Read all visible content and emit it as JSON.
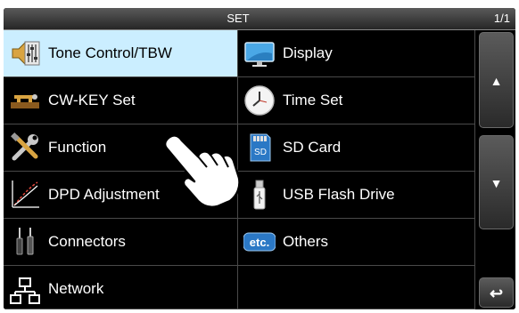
{
  "header": {
    "title": "SET",
    "page": "1/1"
  },
  "menu": {
    "items": [
      {
        "label": "Tone Control/TBW",
        "icon": "tone-control-icon"
      },
      {
        "label": "Display",
        "icon": "monitor-icon"
      },
      {
        "label": "CW-KEY Set",
        "icon": "cw-key-icon"
      },
      {
        "label": "Time Set",
        "icon": "clock-icon"
      },
      {
        "label": "Function",
        "icon": "tools-icon"
      },
      {
        "label": "SD Card",
        "icon": "sd-card-icon",
        "icon_text": "SD"
      },
      {
        "label": "DPD Adjustment",
        "icon": "dpd-graph-icon"
      },
      {
        "label": "USB Flash Drive",
        "icon": "usb-drive-icon"
      },
      {
        "label": "Connectors",
        "icon": "connectors-icon"
      },
      {
        "label": "Others",
        "icon": "others-icon",
        "icon_text": "etc."
      },
      {
        "label": "Network",
        "icon": "network-icon"
      }
    ],
    "selected_index": 0
  },
  "scrollbar": {
    "up": "▲",
    "down": "▼",
    "back": "↩"
  },
  "colors": {
    "selected_bg": "#cbeeff",
    "background": "#000000"
  }
}
